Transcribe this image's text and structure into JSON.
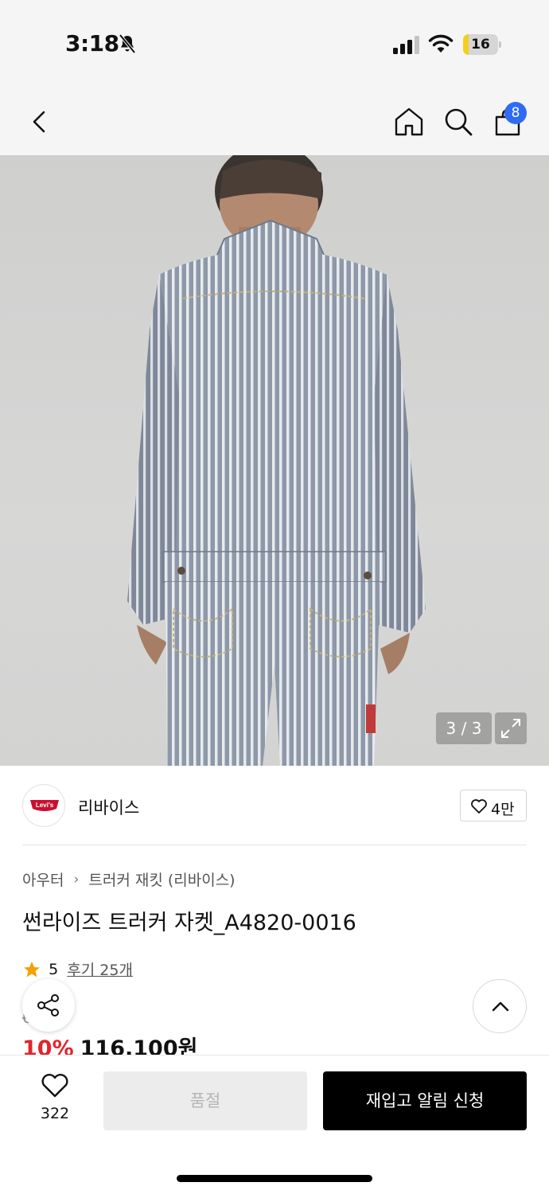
{
  "status_bar": {
    "time": "3:18",
    "battery_level": "16",
    "battery_fraction": 0.16,
    "icons": [
      "bell-slash-icon",
      "cellular-signal-icon",
      "wifi-icon",
      "battery-icon"
    ]
  },
  "nav": {
    "icons": [
      "back-chevron-icon",
      "home-icon",
      "search-icon",
      "shopping-bag-icon"
    ],
    "cart_count": "8",
    "badge_color": "#2f6bf3"
  },
  "gallery": {
    "counter": "3 / 3",
    "expand_icon": "expand-arrows-icon"
  },
  "brand": {
    "logo_text": "Levi's",
    "name": "리바이스",
    "like_count": "4만"
  },
  "product": {
    "breadcrumb": [
      "아우터",
      "트러커 재킷 (리바이스)"
    ],
    "title": "썬라이즈 트러커 자켓_A4820-0016",
    "rating": "5",
    "review_link": "후기 25개",
    "original_price_visible": "000원",
    "discount": "10%",
    "sale_price": "116,100원",
    "accent_color": "#e2252b"
  },
  "floating": {
    "share_icon": "share-icon",
    "top_icon": "chevron-up-icon"
  },
  "bottom_bar": {
    "wish_count": "322",
    "soldout_label": "품절",
    "restock_label": "재입고 알림 신청"
  }
}
